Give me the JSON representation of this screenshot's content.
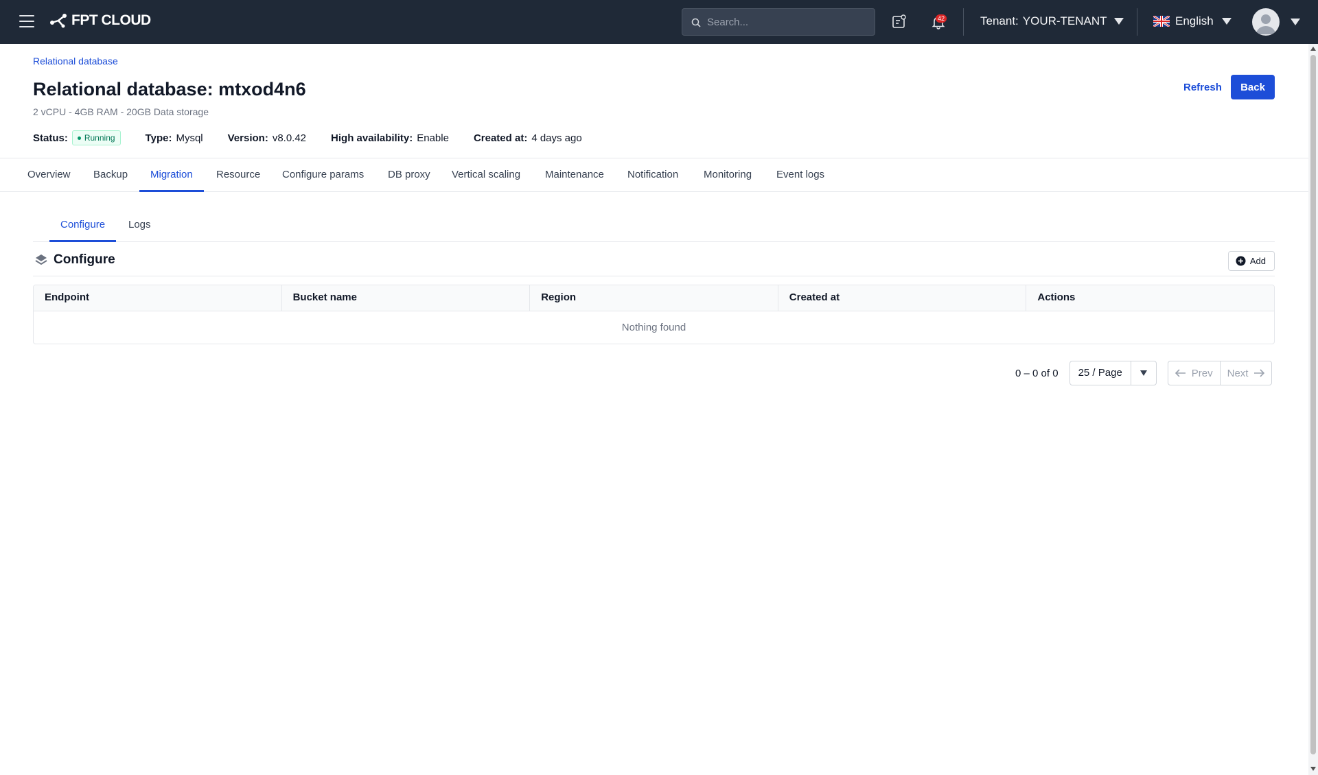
{
  "topbar": {
    "logo": "FPT CLOUD",
    "search_placeholder": "Search...",
    "notification_count": "42",
    "tenant_label": "Tenant:",
    "tenant_value": "YOUR-TENANT",
    "language": "English"
  },
  "header": {
    "breadcrumb": "Relational database",
    "title": "Relational database: mtxod4n6",
    "subtitle": "2 vCPU - 4GB RAM - 20GB Data storage",
    "refresh_label": "Refresh",
    "back_label": "Back",
    "meta": {
      "status_label": "Status:",
      "status_value": "Running",
      "type_label": "Type:",
      "type_value": "Mysql",
      "version_label": "Version:",
      "version_value": "v8.0.42",
      "ha_label": "High availability:",
      "ha_value": "Enable",
      "created_label": "Created at:",
      "created_value": "4 days ago"
    }
  },
  "tabs": [
    "Overview",
    "Backup",
    "Migration",
    "Resource",
    "Configure params",
    "DB proxy",
    "Vertical scaling",
    "Maintenance",
    "Notification",
    "Monitoring",
    "Event logs"
  ],
  "active_tab": "Migration",
  "subtabs": [
    "Configure",
    "Logs"
  ],
  "active_subtab": "Configure",
  "section": {
    "title": "Configure",
    "add_label": "Add"
  },
  "table": {
    "columns": [
      "Endpoint",
      "Bucket name",
      "Region",
      "Created at",
      "Actions"
    ],
    "empty_text": "Nothing found"
  },
  "pagination": {
    "range": "0 – 0 of 0",
    "per_page": "25 / Page",
    "prev": "Prev",
    "next": "Next"
  },
  "colors": {
    "topbar_bg": "#1f2937",
    "accent": "#1d4ed8",
    "status_green": "#047857"
  }
}
